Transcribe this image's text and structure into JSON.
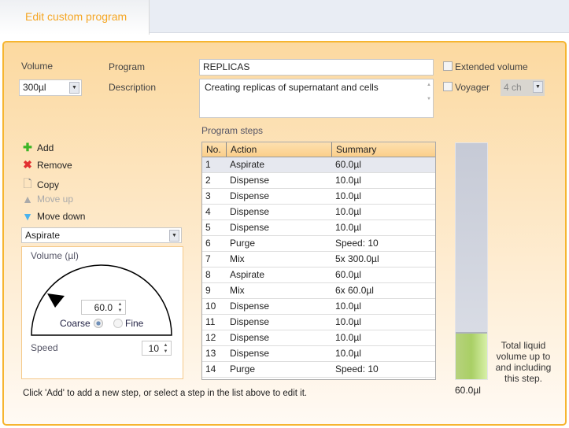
{
  "tab": {
    "title": "Edit custom program"
  },
  "volume": {
    "label": "Volume",
    "value": "300µl"
  },
  "program": {
    "label": "Program",
    "value": "REPLICAS"
  },
  "description": {
    "label": "Description",
    "value": "Creating replicas of supernatant and cells"
  },
  "options": {
    "extended_volume": "Extended volume",
    "voyager": "Voyager",
    "channels": "4 ch"
  },
  "tools": {
    "add": "Add",
    "remove": "Remove",
    "copy": "Copy",
    "move_up": "Move up",
    "move_down": "Move down"
  },
  "step_editor": {
    "action": "Aspirate",
    "volume_label": "Volume (µl)",
    "volume_value": "60.0",
    "coarse": "Coarse",
    "fine": "Fine",
    "speed_label": "Speed",
    "speed_value": "10"
  },
  "steps": {
    "title": "Program steps",
    "headers": [
      "No.",
      "Action",
      "Summary"
    ],
    "selected": 0,
    "rows": [
      [
        "1",
        "Aspirate",
        "60.0µl"
      ],
      [
        "2",
        "Dispense",
        "10.0µl"
      ],
      [
        "3",
        "Dispense",
        "10.0µl"
      ],
      [
        "4",
        "Dispense",
        "10.0µl"
      ],
      [
        "5",
        "Dispense",
        "10.0µl"
      ],
      [
        "6",
        "Purge",
        "Speed: 10"
      ],
      [
        "7",
        "Mix",
        "5x 300.0µl"
      ],
      [
        "8",
        "Aspirate",
        "60.0µl"
      ],
      [
        "9",
        "Mix",
        "6x 60.0µl"
      ],
      [
        "10",
        "Dispense",
        "10.0µl"
      ],
      [
        "11",
        "Dispense",
        "10.0µl"
      ],
      [
        "12",
        "Dispense",
        "10.0µl"
      ],
      [
        "13",
        "Dispense",
        "10.0µl"
      ],
      [
        "14",
        "Purge",
        "Speed: 10"
      ]
    ]
  },
  "gauge": {
    "fill_fraction": 0.2,
    "value": "60.0µl",
    "caption": "Total liquid volume up to and including this step."
  },
  "hint": "Click 'Add' to add a new step, or select a step in the list above to edit it."
}
